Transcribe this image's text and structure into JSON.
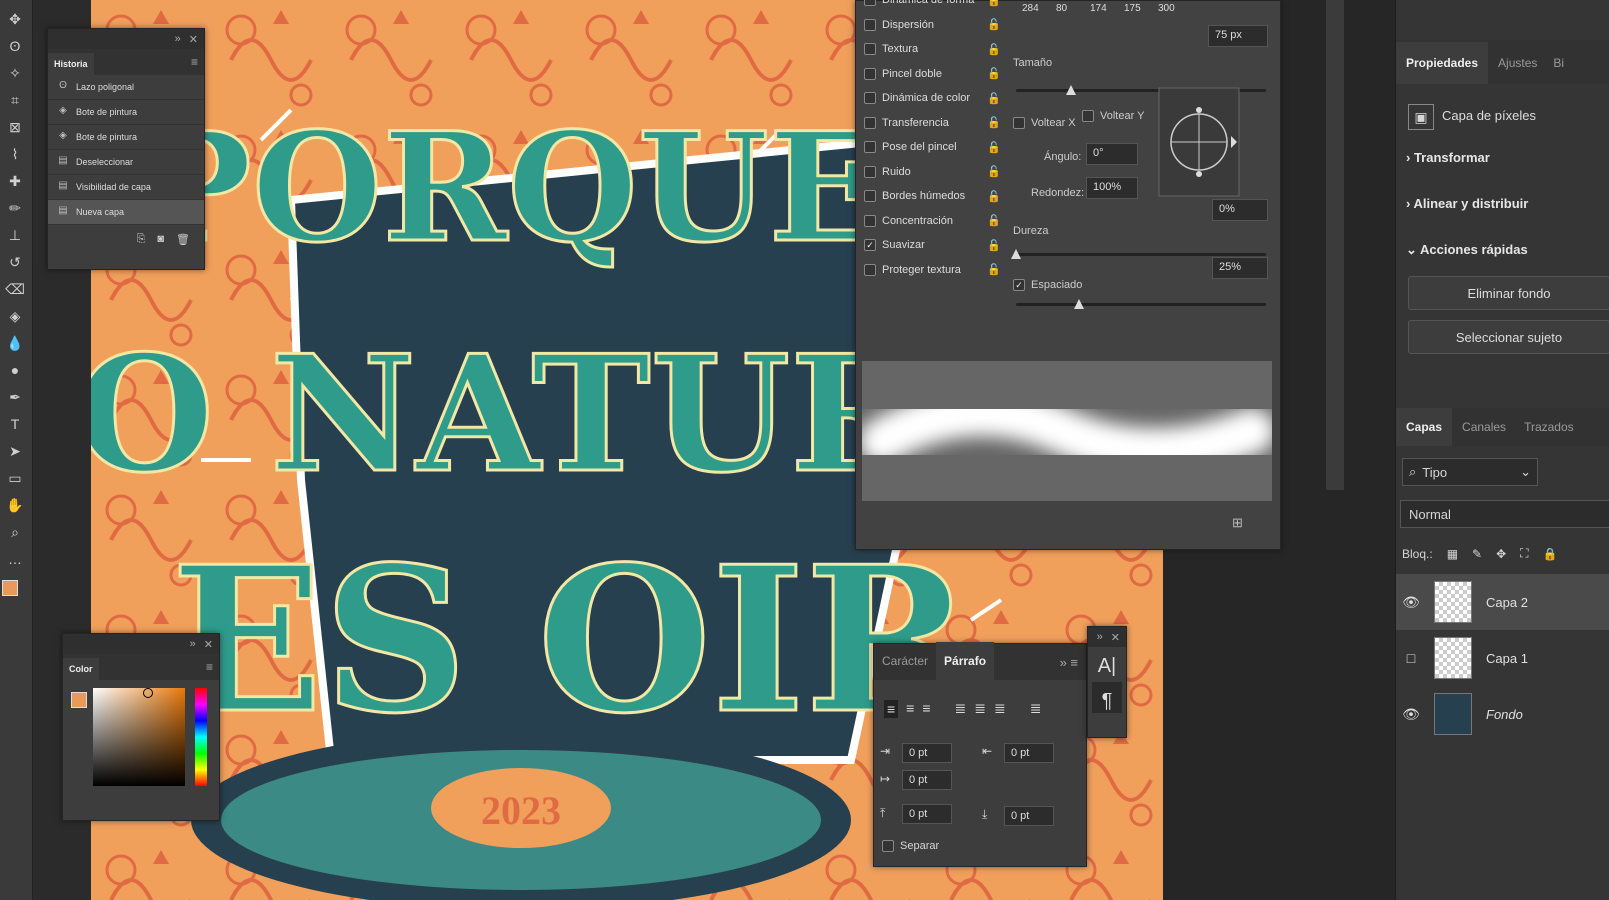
{
  "colors": {
    "orange": "#f1a05c",
    "teal": "#2f9b8a",
    "navy": "#27404f",
    "fg": "#e89a5a"
  },
  "toolbar": {
    "icons": [
      "move-icon",
      "lasso-icon",
      "quick-select-icon",
      "crop-icon",
      "frame-icon",
      "eyedropper-icon",
      "healing-icon",
      "brush-icon",
      "stamp-icon",
      "history-brush-icon",
      "eraser-icon",
      "bucket-icon",
      "blur-icon",
      "dodge-icon",
      "pen-icon",
      "type-icon",
      "path-select-icon",
      "rectangle-icon",
      "hand-icon",
      "zoom-icon",
      "more-icon"
    ]
  },
  "historia": {
    "title": "Historia",
    "items": [
      {
        "label": "Lazo poligonal",
        "icon": "lasso-icon"
      },
      {
        "label": "Bote de pintura",
        "icon": "bucket-icon"
      },
      {
        "label": "Bote de pintura",
        "icon": "bucket-icon"
      },
      {
        "label": "Deseleccionar",
        "icon": "doc-icon"
      },
      {
        "label": "Visibilidad de capa",
        "icon": "doc-icon"
      },
      {
        "label": "Nueva capa",
        "icon": "doc-icon"
      }
    ]
  },
  "color_panel": {
    "title": "Color"
  },
  "artwork": {
    "line1": "PORQUE",
    "line2": "LO NATURAL",
    "line3": "ES OIR",
    "year": "2023"
  },
  "brush": {
    "options": [
      {
        "label": "Dinámica de forma",
        "checked": false
      },
      {
        "label": "Dispersión",
        "checked": false
      },
      {
        "label": "Textura",
        "checked": false
      },
      {
        "label": "Pincel doble",
        "checked": false
      },
      {
        "label": "Dinámica de color",
        "checked": false
      },
      {
        "label": "Transferencia",
        "checked": false
      },
      {
        "label": "Pose del pincel",
        "checked": false
      },
      {
        "label": "Ruido",
        "checked": false
      },
      {
        "label": "Bordes húmedos",
        "checked": false
      },
      {
        "label": "Concentración",
        "checked": false
      },
      {
        "label": "Suavizar",
        "checked": true
      },
      {
        "label": "Proteger textura",
        "checked": false
      }
    ],
    "presets": [
      "284",
      "80",
      "174",
      "175",
      "300"
    ],
    "size_value": "75 px",
    "size_label": "Tamaño",
    "flip_x": "Voltear X",
    "flip_y": "Voltear Y",
    "angle_label": "Ángulo:",
    "angle_value": "0°",
    "round_label": "Redondez:",
    "round_value": "100%",
    "hardness_label": "Dureza",
    "hardness_value": "0%",
    "spacing_label": "Espaciado",
    "spacing_value": "25%",
    "size_level": 0.22,
    "hardness_level": 0.0,
    "spacing_level": 0.25
  },
  "parrafo": {
    "tabs": [
      "Carácter",
      "Párrafo"
    ],
    "fields": [
      "0 pt",
      "0 pt",
      "0 pt",
      "0 pt",
      "0 pt",
      "0 pt"
    ],
    "separar": "Separar"
  },
  "dock": {
    "props_tabs": [
      "Propiedades",
      "Ajustes",
      "Bi"
    ],
    "pixel_layer": "Capa de píxeles",
    "transformar": "Transformar",
    "alinear": "Alinear y distribuir",
    "acciones": "Acciones rápidas",
    "eliminar_fondo": "Eliminar fondo",
    "seleccionar_sujeto": "Seleccionar sujeto",
    "layers_tabs": [
      "Capas",
      "Canales",
      "Trazados"
    ],
    "filter": "Tipo",
    "blend": "Normal",
    "lock_label": "Bloq.:",
    "layers": [
      {
        "name": "Capa 2",
        "visible": true,
        "selected": true
      },
      {
        "name": "Capa 1",
        "visible": false,
        "selected": false
      },
      {
        "name": "Fondo",
        "visible": true,
        "selected": false
      }
    ]
  }
}
